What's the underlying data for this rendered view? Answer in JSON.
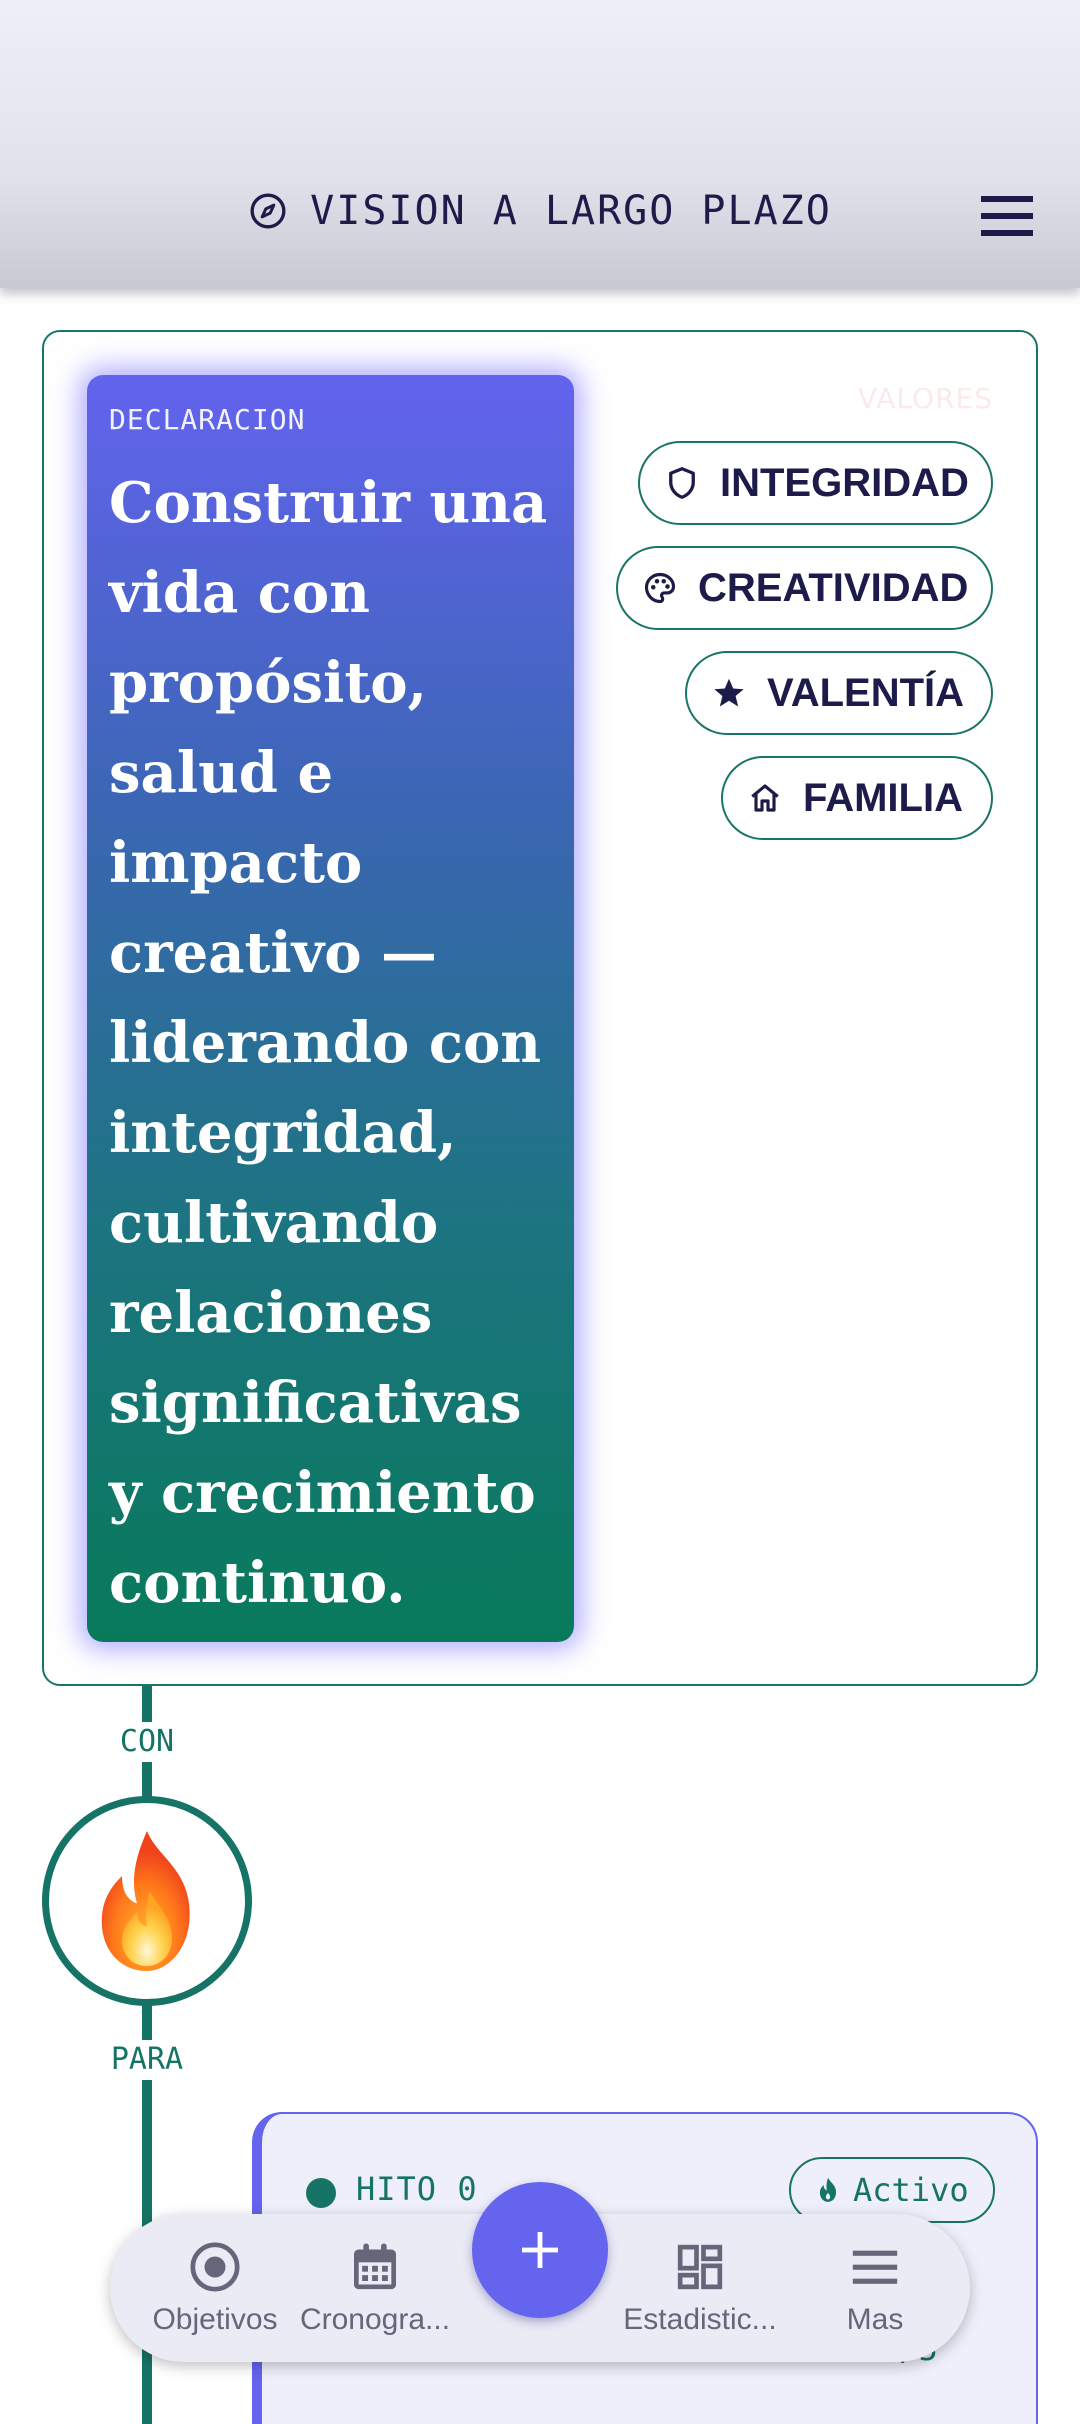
{
  "app_bar": {
    "title": "VISION A LARGO PLAZO",
    "icons": {
      "title_icon": "compass-icon",
      "menu": "hamburger-menu-icon"
    }
  },
  "vision": {
    "statement_label": "DECLARACION",
    "statement_text": "Construir una vida con propósito, salud e impacto creativo — liderando con integridad, cultivando relaciones significativas y crecimiento continuo.",
    "values_label": "VALORES",
    "values": [
      {
        "label": "INTEGRIDAD",
        "icon": "shield-icon"
      },
      {
        "label": "CREATIVIDAD",
        "icon": "palette-icon"
      },
      {
        "label": "VALENTÍA",
        "icon": "star-icon"
      },
      {
        "label": "FAMILIA",
        "icon": "home-icon"
      }
    ]
  },
  "timeline": {
    "connector_top": "CON",
    "node_icon": "fire-emoji",
    "connector_bottom": "PARA"
  },
  "milestone": {
    "label": "HITO 0",
    "status": "Activo",
    "status_icon": "flame-icon",
    "count": "7/5"
  },
  "bottom_nav": {
    "items": [
      {
        "label": "Objetivos",
        "icon": "target-icon"
      },
      {
        "label": "Cronogra...",
        "icon": "calendar-icon"
      },
      {
        "label": "Estadistic...",
        "icon": "dashboard-icon"
      },
      {
        "label": "Mas",
        "icon": "menu-icon"
      }
    ],
    "fab_icon": "plus-icon"
  },
  "colors": {
    "accent": "#6464ee",
    "teal": "#167466",
    "ink": "#1d1b4a",
    "nav_text": "#66657a"
  }
}
